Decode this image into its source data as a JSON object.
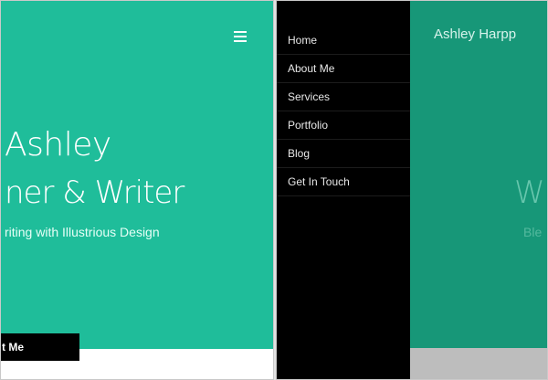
{
  "left_screen": {
    "hero_line1": "Ashley",
    "hero_line2": "ner & Writer",
    "subtitle": "riting with Illustrious Design",
    "cta_label": "t Me",
    "colors": {
      "teal": "#1fbd9a",
      "cta_bg": "#000000"
    }
  },
  "right_screen": {
    "menu": {
      "items": [
        {
          "label": "Home"
        },
        {
          "label": "About Me"
        },
        {
          "label": "Services"
        },
        {
          "label": "Portfolio"
        },
        {
          "label": "Blog"
        },
        {
          "label": "Get In Touch"
        }
      ]
    },
    "page_title": "Ashley Harpp",
    "hero_fragment": "W",
    "subtitle_fragment": "Ble",
    "colors": {
      "menu_bg": "#000000",
      "dimmed_teal": "#179778"
    }
  },
  "icons": {
    "menu_toggle": "hamburger-icon"
  }
}
